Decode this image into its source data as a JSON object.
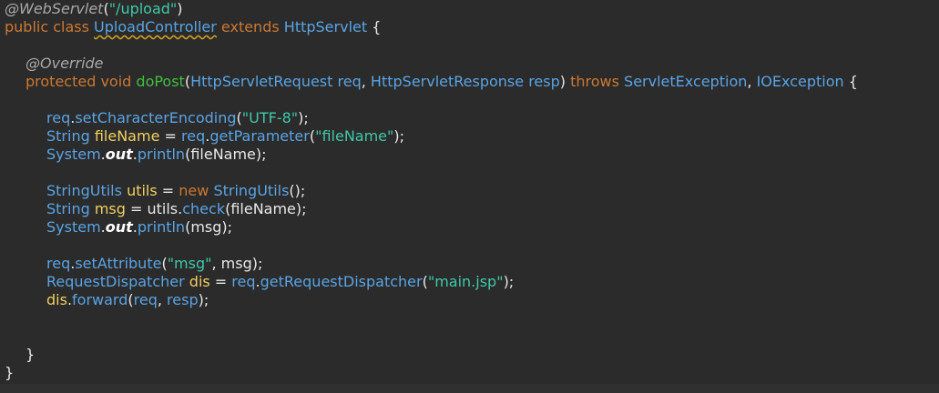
{
  "colors": {
    "background": "#2b2b2b",
    "annotation": "#a8a8a8",
    "keyword": "#cc7832",
    "type": "#5aa4e4",
    "method_decl": "#3fbf3f",
    "string": "#3fc9a8",
    "local_var": "#f0d060",
    "plain": "#e8e8e8"
  },
  "code": {
    "l1": [
      "@WebServlet",
      "(",
      "\"/upload\"",
      ")"
    ],
    "l2": [
      "public",
      " ",
      "class",
      " ",
      "UploadController",
      " ",
      "extends",
      " ",
      "HttpServlet",
      " {"
    ],
    "l3": [
      "@Override"
    ],
    "l4": [
      "protected",
      " ",
      "void",
      " ",
      "doPost",
      "(",
      "HttpServletRequest",
      " ",
      "req",
      ", ",
      "HttpServletResponse",
      " ",
      "resp",
      ") ",
      "throws",
      " ",
      "ServletException",
      ", ",
      "IOException",
      " {"
    ],
    "l5": [
      "req",
      ".",
      "setCharacterEncoding",
      "(",
      "\"UTF-8\"",
      ");"
    ],
    "l6": [
      "String",
      " ",
      "fileName",
      " = ",
      "req",
      ".",
      "getParameter",
      "(",
      "\"fileName\"",
      ");"
    ],
    "l7": [
      "System",
      ".",
      "out",
      ".",
      "println",
      "(",
      "fileName",
      ");"
    ],
    "l8": [
      "StringUtils",
      " ",
      "utils",
      " = ",
      "new",
      " ",
      "StringUtils",
      "();"
    ],
    "l9": [
      "String",
      " ",
      "msg",
      " = ",
      "utils",
      ".",
      "check",
      "(",
      "fileName",
      ");"
    ],
    "l10": [
      "System",
      ".",
      "out",
      ".",
      "println",
      "(",
      "msg",
      ");"
    ],
    "l11": [
      "req",
      ".",
      "setAttribute",
      "(",
      "\"msg\"",
      ", ",
      "msg",
      ");"
    ],
    "l12": [
      "RequestDispatcher",
      " ",
      "dis",
      " = ",
      "req",
      ".",
      "getRequestDispatcher",
      "(",
      "\"main.jsp\"",
      ");"
    ],
    "l13": [
      "dis",
      ".",
      "forward",
      "(",
      "req",
      ", ",
      "resp",
      ");"
    ],
    "l14": [
      "}"
    ],
    "l15": [
      "}"
    ]
  }
}
